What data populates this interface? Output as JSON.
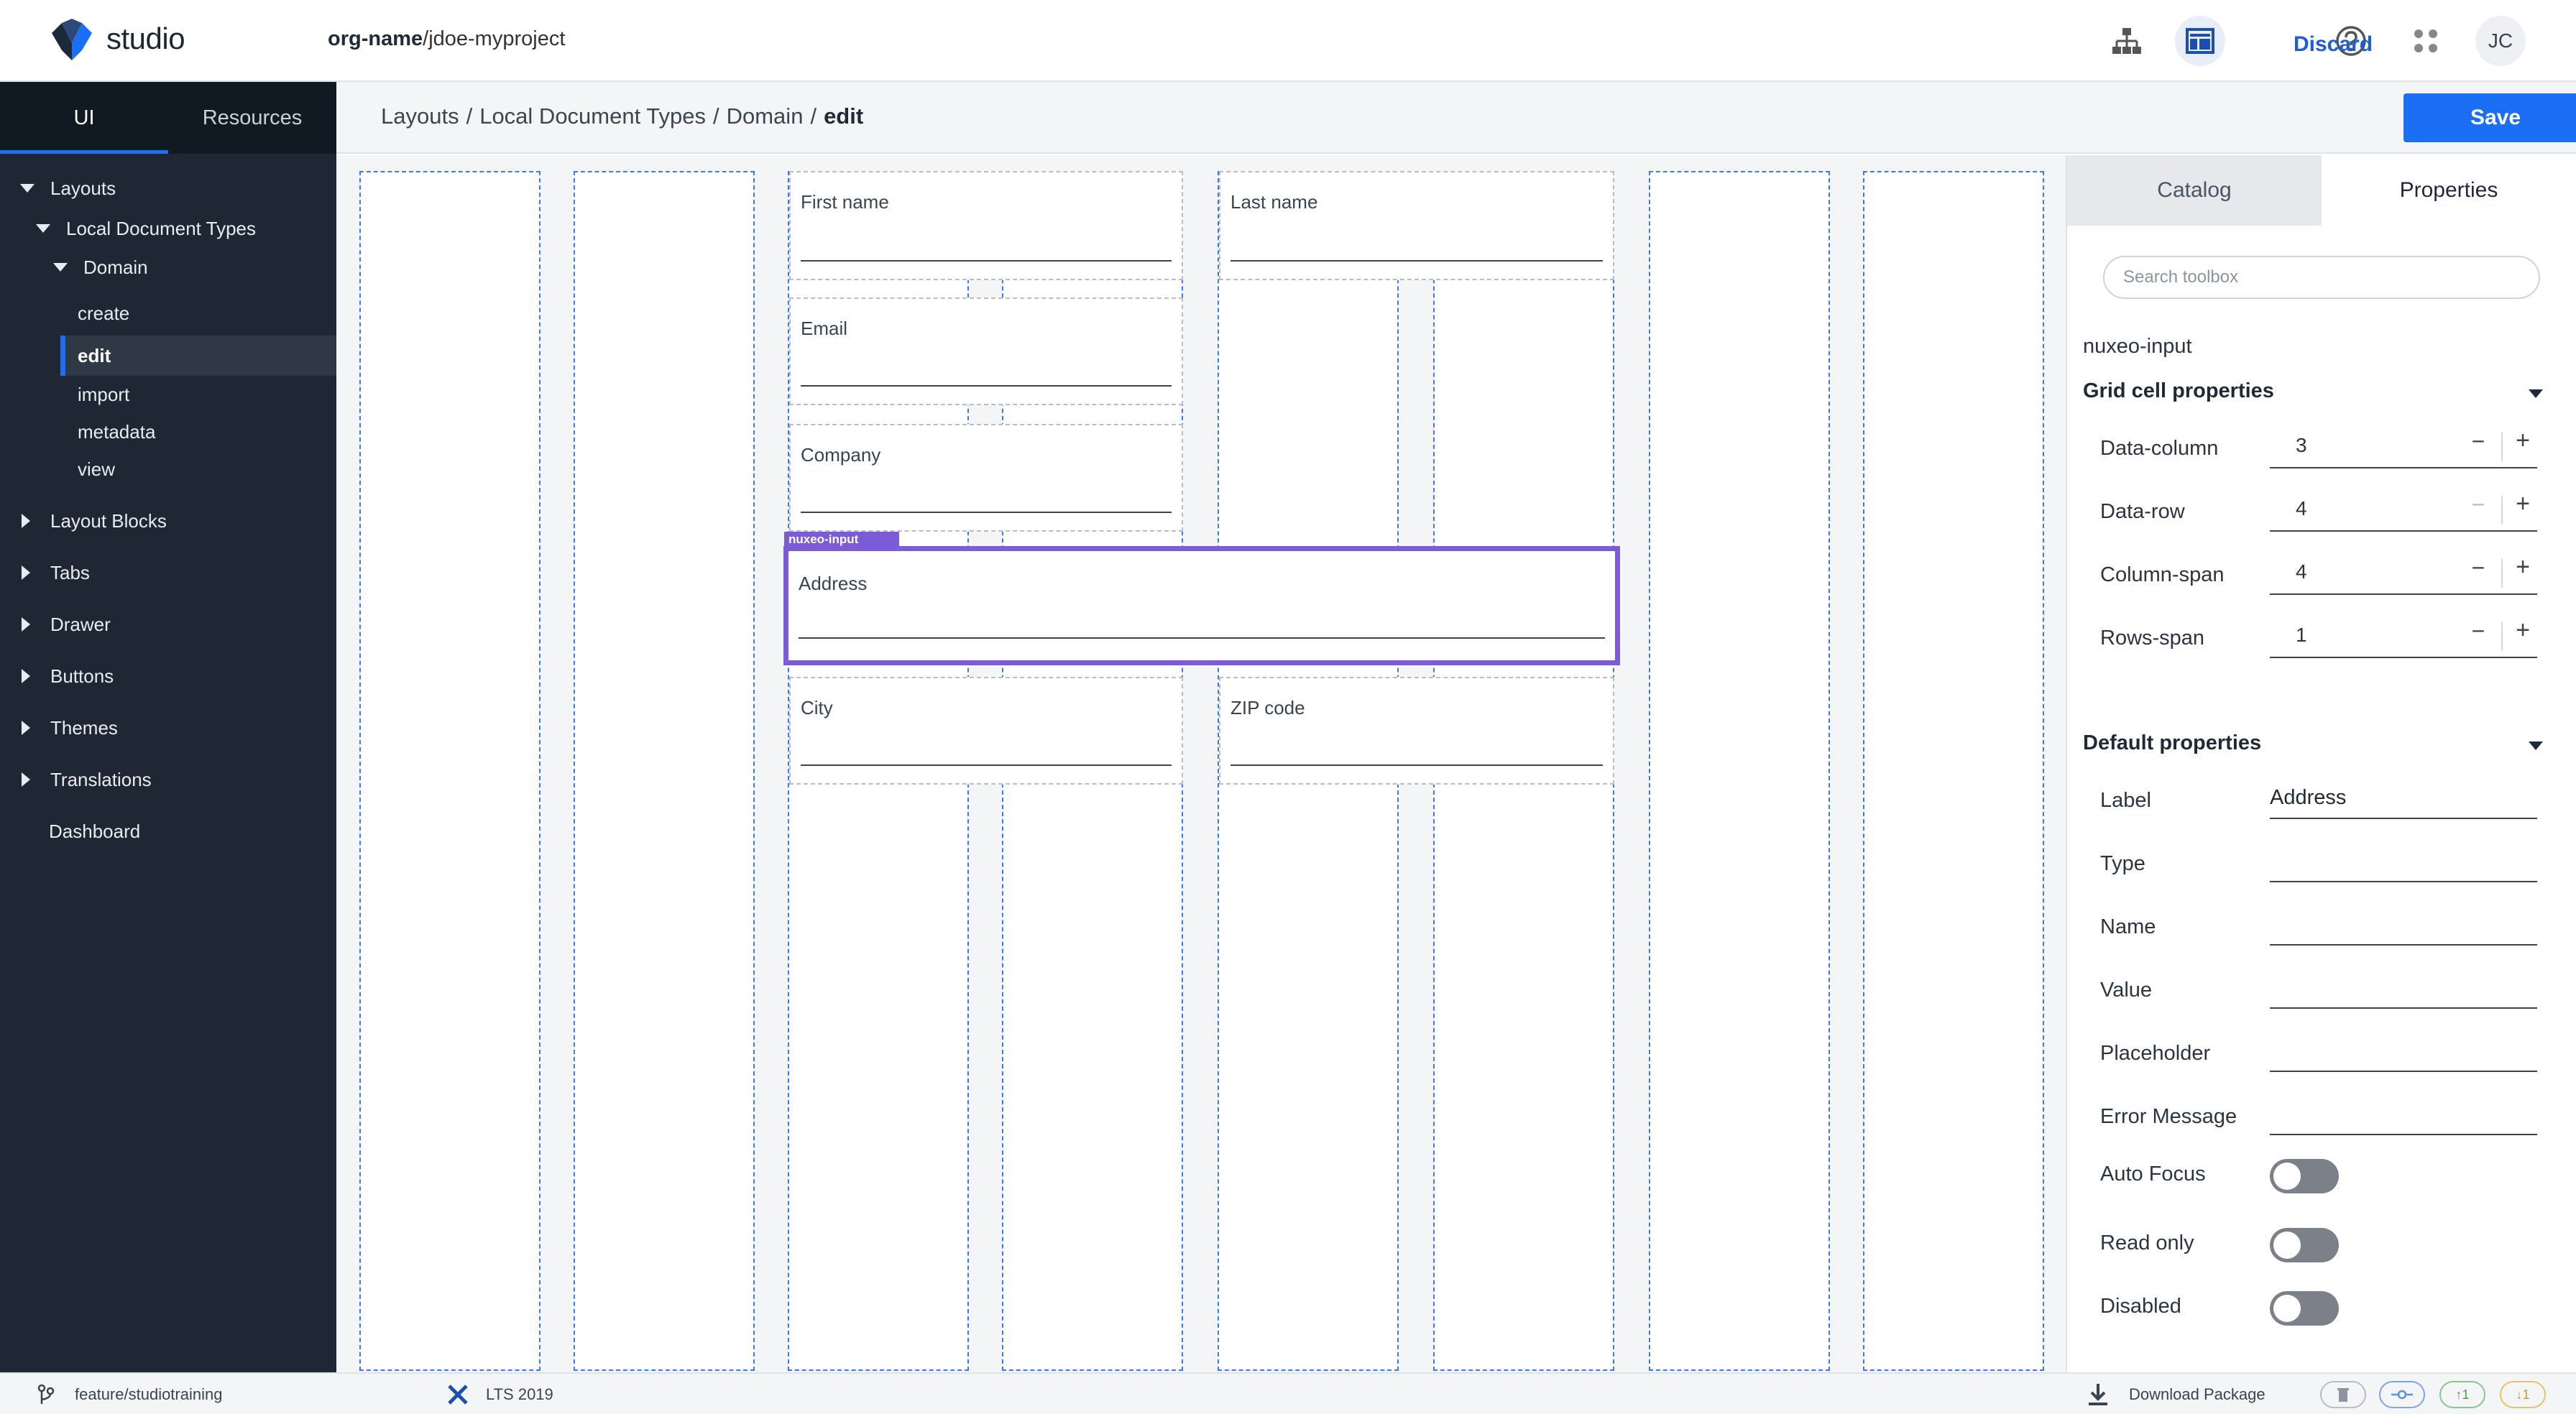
{
  "topbar": {
    "brand": "studio",
    "org": "org-name",
    "project": "/jdoe-myproject",
    "icons": [
      "hierarchy-icon",
      "layout-designer-icon",
      "help-icon",
      "apps-grid-icon"
    ],
    "avatar_initials": "JC"
  },
  "sidebar": {
    "tabs": [
      "UI",
      "Resources"
    ],
    "active_tab": "UI",
    "tree": {
      "layouts": "Layouts",
      "local_doc_types": "Local Document Types",
      "domain": "Domain",
      "leaves": [
        "create",
        "edit",
        "import",
        "metadata",
        "view"
      ],
      "selected": "edit",
      "sections": [
        "Layout Blocks",
        "Tabs",
        "Drawer",
        "Buttons",
        "Themes",
        "Translations"
      ],
      "dashboard": "Dashboard"
    }
  },
  "header": {
    "breadcrumb": [
      "Layouts",
      "Local Document Types",
      "Domain"
    ],
    "breadcrumb_current": "edit",
    "discard_label": "Discard",
    "save_label": "Save",
    "accent_color": "#1a6ff5"
  },
  "canvas": {
    "fields": {
      "first_name": "First name",
      "last_name": "Last name",
      "email": "Email",
      "company": "Company",
      "address": "Address",
      "city": "City",
      "zip": "ZIP code"
    },
    "selected_tag": "nuxeo-input",
    "selection_color": "#7b5cd6"
  },
  "properties": {
    "tabs": [
      "Catalog",
      "Properties"
    ],
    "active_tab": "Properties",
    "search_placeholder": "Search toolbox",
    "element_name": "nuxeo-input",
    "grid_section_title": "Grid cell properties",
    "grid": {
      "data_column_label": "Data-column",
      "data_column": "3",
      "data_row_label": "Data-row",
      "data_row": "4",
      "column_span_label": "Column-span",
      "column_span": "4",
      "rows_span_label": "Rows-span",
      "rows_span": "1"
    },
    "default_section_title": "Default properties",
    "defaults": {
      "label_label": "Label",
      "label_value": "Address",
      "type_label": "Type",
      "name_label": "Name",
      "value_label": "Value",
      "placeholder_label": "Placeholder",
      "error_label": "Error Message",
      "autofocus_label": "Auto Focus",
      "readonly_label": "Read only",
      "disabled_label": "Disabled"
    }
  },
  "footer": {
    "branch": "feature/studiotraining",
    "target": "LTS 2019",
    "download": "Download Package",
    "pill_up": "↑1",
    "pill_down": "↓1"
  }
}
